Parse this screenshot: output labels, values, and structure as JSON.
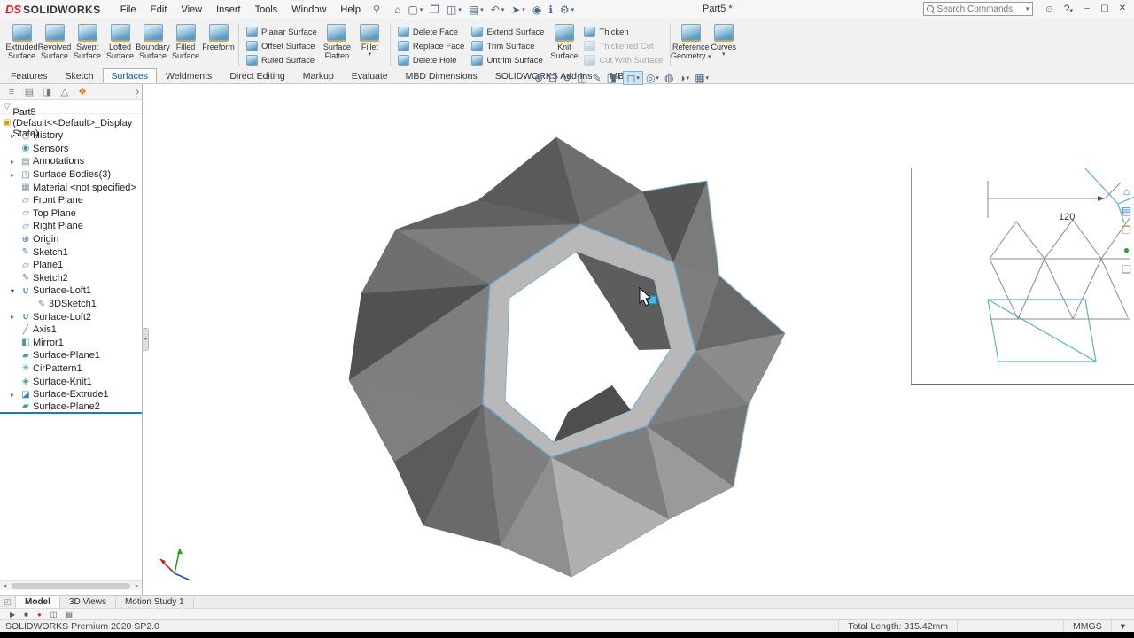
{
  "common": {
    "dropdown": "▾",
    "chevron": "›",
    "funnel": "▽",
    "corner": "◰",
    "scroll_left": "◂",
    "scroll_right": "▸",
    "splitter": "◂"
  },
  "titlebar": {
    "brand_ds": "DS",
    "brand": "SOLIDWORKS",
    "title": "Part5 *",
    "search_placeholder": "Search Commands",
    "help_label": "?",
    "menus": [
      "File",
      "Edit",
      "View",
      "Insert",
      "Tools",
      "Window",
      "Help"
    ],
    "pin_icon": "⚲",
    "qat": [
      {
        "name": "home-button",
        "g": "⌂"
      },
      {
        "name": "new-document-button",
        "g": "▢",
        "dd": "true"
      },
      {
        "name": "open-button",
        "g": "❐"
      },
      {
        "name": "save-button",
        "g": "◫",
        "dd": "true"
      },
      {
        "name": "print-button",
        "g": "▤",
        "dd": "true"
      },
      {
        "name": "undo-button",
        "g": "↶",
        "dd": "true"
      },
      {
        "name": "select-button",
        "g": "➤",
        "dd": "true"
      },
      {
        "name": "rebuild-button",
        "g": "◉"
      },
      {
        "name": "file-properties-button",
        "g": "ℹ"
      },
      {
        "name": "options-button",
        "g": "⚙",
        "dd": "true"
      }
    ],
    "user_icon": "☺",
    "window_buttons": {
      "minimize": "–",
      "maximize": "▢",
      "close": "✕"
    }
  },
  "ribbon": {
    "large1": [
      {
        "l1": "Extruded",
        "l2": "Surface"
      },
      {
        "l1": "Revolved",
        "l2": "Surface"
      },
      {
        "l1": "Swept",
        "l2": "Surface"
      },
      {
        "l1": "Lofted",
        "l2": "Surface"
      },
      {
        "l1": "Boundary",
        "l2": "Surface"
      },
      {
        "l1": "Filled",
        "l2": "Surface"
      },
      {
        "l1": "Freeform",
        "l2": " "
      }
    ],
    "col1": [
      {
        "label": "Planar Surface"
      },
      {
        "label": "Offset Surface"
      },
      {
        "label": "Ruled Surface"
      }
    ],
    "flatten": {
      "l1": "Surface",
      "l2": "Flatten"
    },
    "fillet": {
      "l1": "Fillet",
      "l2": " "
    },
    "col2": [
      {
        "label": "Delete Face"
      },
      {
        "label": "Replace Face"
      },
      {
        "label": "Delete Hole"
      }
    ],
    "col3": [
      {
        "label": "Extend Surface"
      },
      {
        "label": "Trim Surface"
      },
      {
        "label": "Untrim Surface"
      }
    ],
    "knit": {
      "l1": "Knit",
      "l2": "Surface"
    },
    "col4": [
      {
        "label": "Thicken"
      },
      {
        "label": "Thickened Cut",
        "disabled": "true"
      },
      {
        "label": "Cut With Surface",
        "disabled": "true"
      }
    ],
    "refgeo": {
      "l1": "Reference",
      "l2": "Geometry"
    },
    "curves": {
      "l1": "Curves",
      "l2": " "
    }
  },
  "tabs": [
    {
      "label": "Features"
    },
    {
      "label": "Sketch"
    },
    {
      "label": "Surfaces",
      "active": "true"
    },
    {
      "label": "Weldments"
    },
    {
      "label": "Direct Editing"
    },
    {
      "label": "Markup"
    },
    {
      "label": "Evaluate"
    },
    {
      "label": "MBD Dimensions"
    },
    {
      "label": "SOLIDWORKS Add-Ins"
    },
    {
      "label": "MBD"
    }
  ],
  "headsup": [
    {
      "name": "zoom-fit-button",
      "g": "⊕"
    },
    {
      "name": "zoom-area-button",
      "g": "⊡"
    },
    {
      "name": "previous-view-button",
      "g": "↺"
    },
    {
      "name": "section-view-button",
      "g": "◫"
    },
    {
      "name": "dynamic-annotation-views-button",
      "g": "✎"
    },
    {
      "name": "view-orientation-button",
      "g": "◨",
      "dd": "true"
    },
    {
      "name": "display-style-button",
      "g": "◻",
      "dd": "true",
      "active": "true"
    },
    {
      "name": "hide-show-items-button",
      "g": "◎",
      "dd": "true"
    },
    {
      "name": "edit-appearance-button",
      "g": "◍"
    },
    {
      "name": "apply-scene-button",
      "g": "◑",
      "dd": "true"
    },
    {
      "name": "view-settings-button",
      "g": "▦",
      "dd": "true"
    }
  ],
  "tree": {
    "root": "Part5 (Default<<Default>_Display State)",
    "items": [
      {
        "label": "History",
        "icon": "history",
        "arrow": "right"
      },
      {
        "label": "Sensors",
        "icon": "sensors"
      },
      {
        "label": "Annotations",
        "icon": "annotations",
        "arrow": "right"
      },
      {
        "label": "Surface Bodies(3)",
        "icon": "bodies",
        "arrow": "right"
      },
      {
        "label": "Material <not specified>",
        "icon": "material"
      },
      {
        "label": "Front Plane",
        "icon": "plane"
      },
      {
        "label": "Top Plane",
        "icon": "plane"
      },
      {
        "label": "Right Plane",
        "icon": "plane"
      },
      {
        "label": "Origin",
        "icon": "origin"
      },
      {
        "label": "Sketch1",
        "icon": "sketch"
      },
      {
        "label": "Plane1",
        "icon": "plane"
      },
      {
        "label": "Sketch2",
        "icon": "sketch"
      },
      {
        "label": "Surface-Loft1",
        "icon": "loft",
        "arrow": "down"
      },
      {
        "label": "3DSketch1",
        "icon": "sketch3d",
        "level": "2"
      },
      {
        "label": "Surface-Loft2",
        "icon": "loft",
        "arrow": "right"
      },
      {
        "label": "Axis1",
        "icon": "axis"
      },
      {
        "label": "Mirror1",
        "icon": "mirror"
      },
      {
        "label": "Surface-Plane1",
        "icon": "planesurf"
      },
      {
        "label": "CirPattern1",
        "icon": "cirpattern"
      },
      {
        "label": "Surface-Knit1",
        "icon": "knit"
      },
      {
        "label": "Surface-Extrude1",
        "icon": "extrude",
        "arrow": "right"
      },
      {
        "label": "Surface-Plane2",
        "icon": "planesurf",
        "selected": "true"
      }
    ]
  },
  "taskstrip": [
    {
      "name": "taskpane-home-button",
      "g": "⌂"
    },
    {
      "name": "taskpane-design-library-button",
      "g": "▤"
    },
    {
      "name": "taskpane-file-explorer-button",
      "g": "❐"
    },
    {
      "name": "taskpane-appearances-button",
      "g": "●"
    },
    {
      "name": "taskpane-custom-properties-button",
      "g": "❏"
    }
  ],
  "rightpanel": {
    "dimension": "120"
  },
  "bottomtabs": [
    {
      "label": "Model",
      "active": "true"
    },
    {
      "label": "3D Views"
    },
    {
      "label": "Motion Study 1"
    }
  ],
  "motionbar": [
    {
      "name": "play-button",
      "g": "▶"
    },
    {
      "name": "stop-button",
      "g": "■"
    },
    {
      "name": "record-button",
      "g": "●"
    },
    {
      "name": "save-animation-button",
      "g": "◫"
    },
    {
      "name": "animation-properties-button",
      "g": "▤"
    }
  ],
  "statusbar": {
    "left": "SOLIDWORKS Premium 2020 SP2.0",
    "total_length": "Total Length: 315.42mm",
    "units": "MMGS",
    "expand_icon": "▾"
  }
}
